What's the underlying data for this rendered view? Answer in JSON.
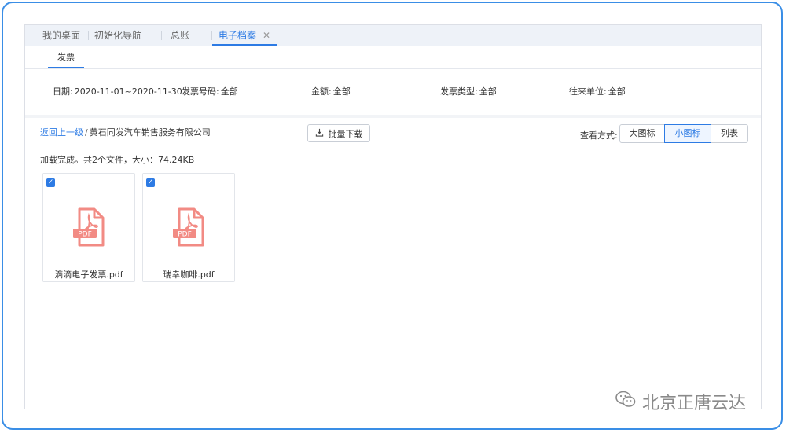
{
  "tabs": [
    {
      "label": "我的桌面"
    },
    {
      "label": "初始化导航"
    },
    {
      "label": "总账"
    },
    {
      "label": "电子档案",
      "close": "✕"
    }
  ],
  "subtab": {
    "label": "发票"
  },
  "filters": {
    "date_label": "日期:",
    "date_value": "2020-11-01~2020-11-30",
    "number_label": "发票号码:",
    "number_value": "全部",
    "amount_label": "金额:",
    "amount_value": "全部",
    "type_label": "发票类型:",
    "type_value": "全部",
    "partner_label": "往来单位:",
    "partner_value": "全部"
  },
  "breadcrumb": {
    "back": "返回上一级",
    "sep": "/",
    "current": "黄石同发汽车销售服务有限公司"
  },
  "batch_download": {
    "label": "批量下载",
    "icon": "download-icon"
  },
  "view": {
    "label": "查看方式:",
    "options": [
      "大图标",
      "小图标",
      "列表"
    ],
    "selected": "小图标"
  },
  "status": "加载完成。共2个文件，大小：74.24KB",
  "files": [
    {
      "name": "滴滴电子发票.pdf",
      "checked": true,
      "icon": "pdf-file-icon",
      "badge": "PDF"
    },
    {
      "name": "瑞幸咖啡.pdf",
      "checked": true,
      "icon": "pdf-file-icon",
      "badge": "PDF"
    }
  ],
  "colors": {
    "accent": "#2d7be4",
    "pdf": "#f28b84",
    "frame": "#3a8ee6"
  },
  "watermark": {
    "text": "北京正唐云达",
    "icon": "wechat-icon"
  }
}
